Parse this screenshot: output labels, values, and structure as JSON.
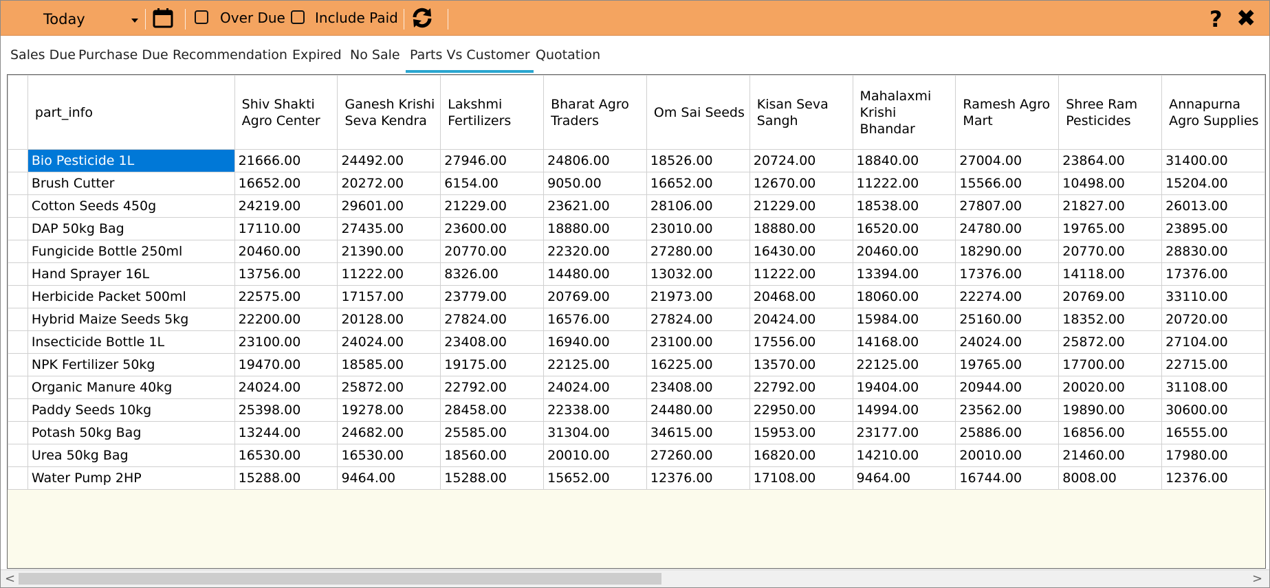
{
  "toolbar": {
    "period_value": "Today",
    "over_due_label": "Over Due",
    "include_paid_label": "Include Paid",
    "help_label": "?",
    "close_label": "✖"
  },
  "tabs": [
    {
      "label": "Sales Due"
    },
    {
      "label": "Purchase Due"
    },
    {
      "label": "Recommendation"
    },
    {
      "label": "Expired"
    },
    {
      "label": "No Sale"
    },
    {
      "label": "Parts Vs Customer"
    },
    {
      "label": "Quotation"
    }
  ],
  "active_tab": "Parts Vs Customer",
  "grid": {
    "headers": [
      "part_info",
      "Shiv Shakti Agro Center",
      "Ganesh Krishi Seva Kendra",
      "Lakshmi Fertilizers",
      "Bharat Agro Traders",
      "Om Sai Seeds",
      "Kisan Seva Sangh",
      "Mahalaxmi Krishi Bhandar",
      "Ramesh Agro Mart",
      "Shree Ram Pesticides",
      "Annapurna Agro Supplies"
    ],
    "rows": [
      [
        "Bio Pesticide 1L",
        "21666.00",
        "24492.00",
        "27946.00",
        "24806.00",
        "18526.00",
        "20724.00",
        "18840.00",
        "27004.00",
        "23864.00",
        "31400.00"
      ],
      [
        "Brush Cutter",
        "16652.00",
        "20272.00",
        "6154.00",
        "9050.00",
        "16652.00",
        "12670.00",
        "11222.00",
        "15566.00",
        "10498.00",
        "15204.00"
      ],
      [
        "Cotton Seeds 450g",
        "24219.00",
        "29601.00",
        "21229.00",
        "23621.00",
        "28106.00",
        "21229.00",
        "18538.00",
        "27807.00",
        "21827.00",
        "26013.00"
      ],
      [
        "DAP 50kg Bag",
        "17110.00",
        "27435.00",
        "23600.00",
        "18880.00",
        "23010.00",
        "18880.00",
        "16520.00",
        "24780.00",
        "19765.00",
        "23895.00"
      ],
      [
        "Fungicide Bottle 250ml",
        "20460.00",
        "21390.00",
        "20770.00",
        "22320.00",
        "27280.00",
        "16430.00",
        "20460.00",
        "18290.00",
        "20770.00",
        "28830.00"
      ],
      [
        "Hand Sprayer 16L",
        "13756.00",
        "11222.00",
        "8326.00",
        "14480.00",
        "13032.00",
        "11222.00",
        "13394.00",
        "17376.00",
        "14118.00",
        "17376.00"
      ],
      [
        "Herbicide Packet 500ml",
        "22575.00",
        "17157.00",
        "23779.00",
        "20769.00",
        "21973.00",
        "20468.00",
        "18060.00",
        "22274.00",
        "20769.00",
        "33110.00"
      ],
      [
        "Hybrid Maize Seeds 5kg",
        "22200.00",
        "20128.00",
        "27824.00",
        "16576.00",
        "27824.00",
        "20424.00",
        "15984.00",
        "25160.00",
        "18352.00",
        "20720.00"
      ],
      [
        "Insecticide Bottle 1L",
        "23100.00",
        "24024.00",
        "23408.00",
        "16940.00",
        "23100.00",
        "17556.00",
        "14168.00",
        "24024.00",
        "25872.00",
        "27104.00"
      ],
      [
        "NPK Fertilizer 50kg",
        "19470.00",
        "18585.00",
        "19175.00",
        "22125.00",
        "16225.00",
        "13570.00",
        "22125.00",
        "19765.00",
        "17700.00",
        "22715.00"
      ],
      [
        "Organic Manure 40kg",
        "24024.00",
        "25872.00",
        "22792.00",
        "24024.00",
        "23408.00",
        "22792.00",
        "19404.00",
        "20944.00",
        "20020.00",
        "31108.00"
      ],
      [
        "Paddy Seeds 10kg",
        "25398.00",
        "19278.00",
        "28458.00",
        "22338.00",
        "24480.00",
        "22950.00",
        "14994.00",
        "23562.00",
        "19890.00",
        "30600.00"
      ],
      [
        "Potash 50kg Bag",
        "13244.00",
        "24682.00",
        "25585.00",
        "31304.00",
        "34615.00",
        "15953.00",
        "23177.00",
        "25886.00",
        "16856.00",
        "16555.00"
      ],
      [
        "Urea 50kg Bag",
        "16530.00",
        "16530.00",
        "18560.00",
        "20010.00",
        "27260.00",
        "16820.00",
        "14210.00",
        "20010.00",
        "21460.00",
        "17980.00"
      ],
      [
        "Water Pump 2HP",
        "15288.00",
        "9464.00",
        "15288.00",
        "15652.00",
        "12376.00",
        "17108.00",
        "9464.00",
        "16744.00",
        "8008.00",
        "12376.00"
      ]
    ]
  },
  "scrollbar": {
    "left_arrow": "<",
    "right_arrow": ">"
  }
}
